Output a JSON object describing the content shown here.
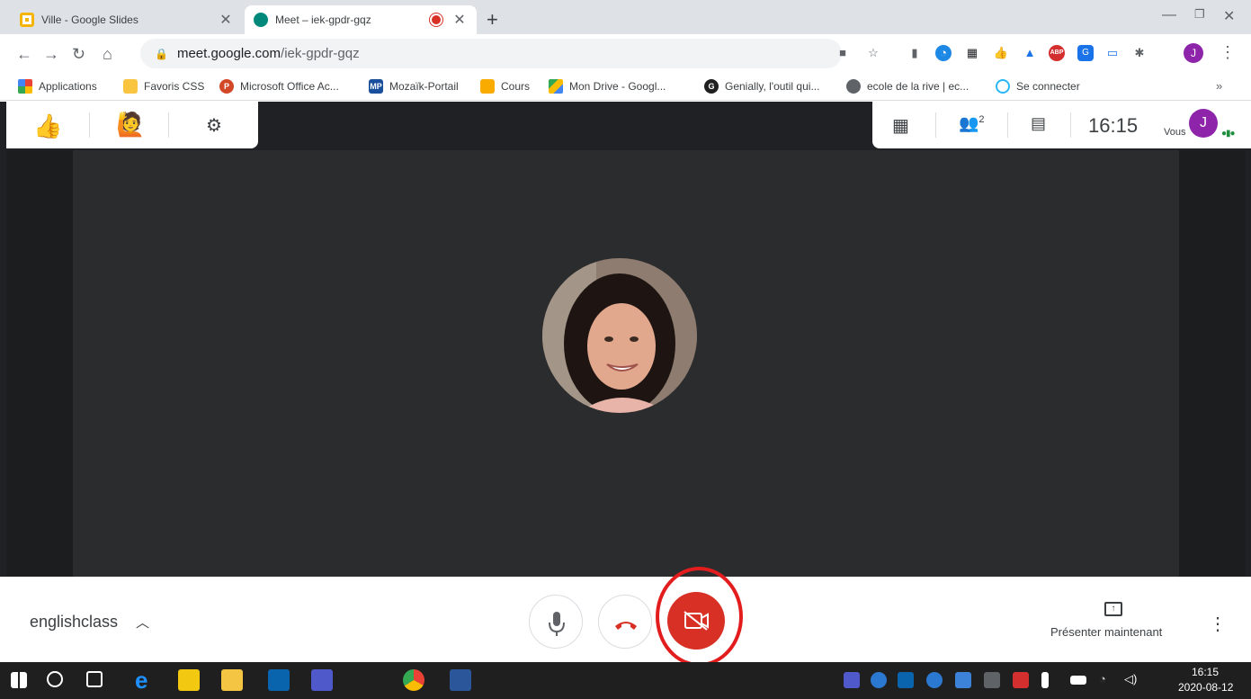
{
  "tabs": [
    {
      "title": "Ville - Google Slides",
      "icon": "slides-icon",
      "color": "#f4b400",
      "active": false
    },
    {
      "title": "Meet – iek-gpdr-gqz",
      "icon": "meet-icon",
      "color": "#00897b",
      "active": true,
      "recording": true
    }
  ],
  "address_bar": {
    "host": "meet.google.com",
    "path": "/iek-gpdr-gqz"
  },
  "profile_initial": "J",
  "bookmarks": [
    {
      "label": "Applications",
      "icon": "apps-grid-icon"
    },
    {
      "label": "Favoris CSS",
      "icon": "folder-icon"
    },
    {
      "label": "Microsoft Office Ac...",
      "icon": "powerpoint-icon"
    },
    {
      "label": "Mozaïk-Portail",
      "icon": "mp-icon",
      "badge": "MP"
    },
    {
      "label": "Cours",
      "icon": "classroom-icon"
    },
    {
      "label": "Mon Drive - Googl...",
      "icon": "drive-icon"
    },
    {
      "label": "Genially, l'outil qui...",
      "icon": "genially-icon"
    },
    {
      "label": "ecole de la rive | ec...",
      "icon": "globe-icon"
    },
    {
      "label": "Se connecter",
      "icon": "link-icon"
    }
  ],
  "bookmarks_more": "»",
  "meet": {
    "time": "16:15",
    "participants_count": "2",
    "self_label": "Vous",
    "self_initial": "J",
    "meeting_name": "englishclass",
    "present_label": "Présenter maintenant"
  },
  "taskbar": {
    "time": "16:15",
    "date": "2020-08-12"
  },
  "colors": {
    "end_call_red": "#d93025",
    "highlight_red": "#e31d1d",
    "meet_bg": "#202124",
    "avatar_purple": "#8e24aa"
  }
}
